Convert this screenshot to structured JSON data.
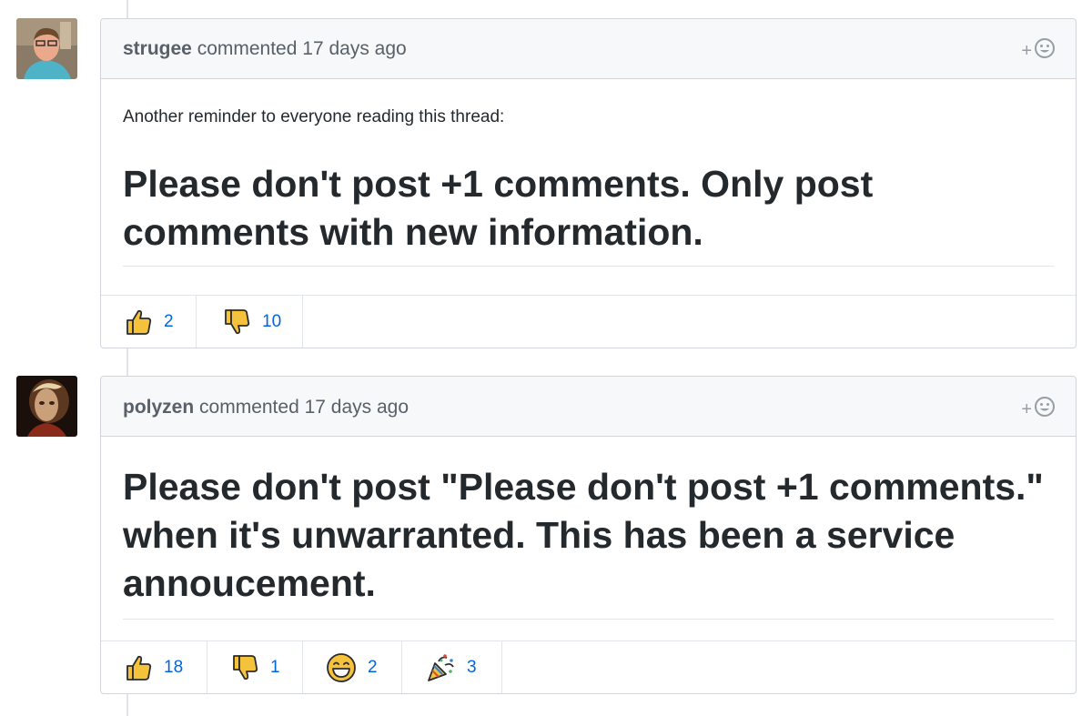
{
  "comments": [
    {
      "author": "strugee",
      "action": "commented",
      "time": "17 days ago",
      "intro": "Another reminder to everyone reading this thread:",
      "heading": "Please don't post +1 comments. Only post comments with new information.",
      "add_reaction": "+",
      "reactions": [
        {
          "icon": "thumbs-up-icon",
          "count": "2"
        },
        {
          "icon": "thumbs-down-icon",
          "count": "10"
        }
      ]
    },
    {
      "author": "polyzen",
      "action": "commented",
      "time": "17 days ago",
      "heading": "Please don't post \"Please don't post +1 comments.\" when it's unwarranted. This has been a service annoucement.",
      "add_reaction": "+",
      "reactions": [
        {
          "icon": "thumbs-up-icon",
          "count": "18"
        },
        {
          "icon": "thumbs-down-icon",
          "count": "1"
        },
        {
          "icon": "laugh-icon",
          "count": "2"
        },
        {
          "icon": "hooray-icon",
          "count": "3"
        }
      ]
    }
  ],
  "colors": {
    "link": "#0366d6",
    "header_bg": "#f6f8fa",
    "border": "#d1d5da",
    "emoji": "#f5c33b"
  }
}
